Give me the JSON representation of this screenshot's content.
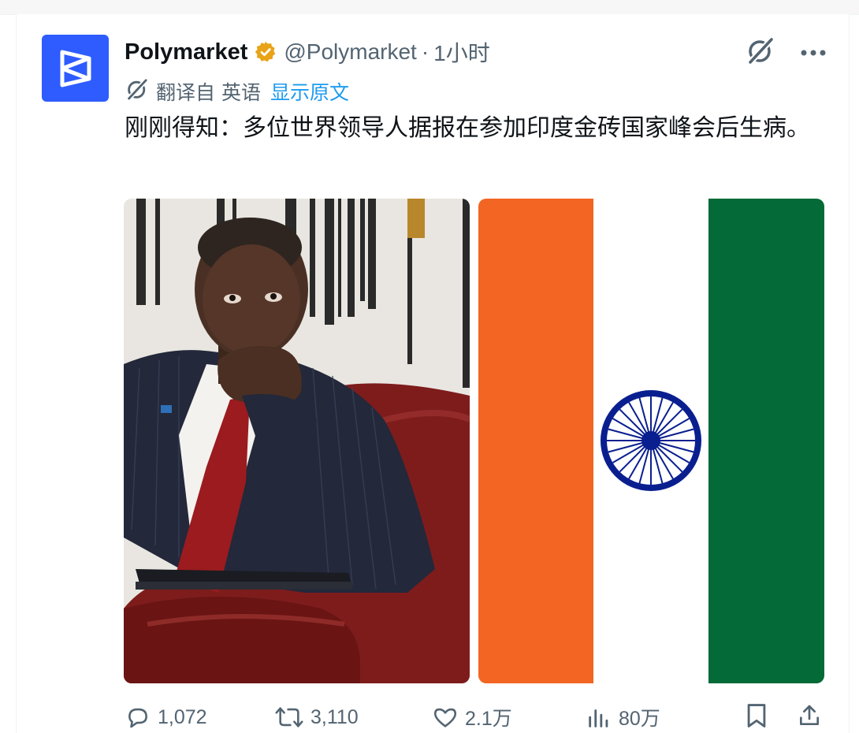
{
  "tweet": {
    "author": {
      "name": "Polymarket",
      "handle": "@Polymarket",
      "verified_badge": "gold-verified-icon",
      "avatar_color": "#2e5cff"
    },
    "separator": "·",
    "time": "1小时",
    "translation": {
      "label": "翻译自 英语",
      "show_original": "显示原文"
    },
    "text": "刚刚得知：多位世界领导人据报在参加印度金砖国家峰会后生病。",
    "media": [
      {
        "type": "photo",
        "depicts": "man-in-pinstripe-suit-seated-in-red-chair"
      },
      {
        "type": "photo",
        "depicts": "flag-of-india",
        "colors": {
          "saffron": "#f26522",
          "white": "#ffffff",
          "green": "#046a38",
          "chakra": "#0a1f8f"
        }
      }
    ],
    "stats": {
      "replies": "1,072",
      "retweets": "3,110",
      "likes": "2.1万",
      "views": "80万"
    }
  },
  "colors": {
    "text_primary": "#0f1419",
    "text_secondary": "#536471",
    "link": "#1d9bf0",
    "verified_gold": "#e8a317"
  }
}
